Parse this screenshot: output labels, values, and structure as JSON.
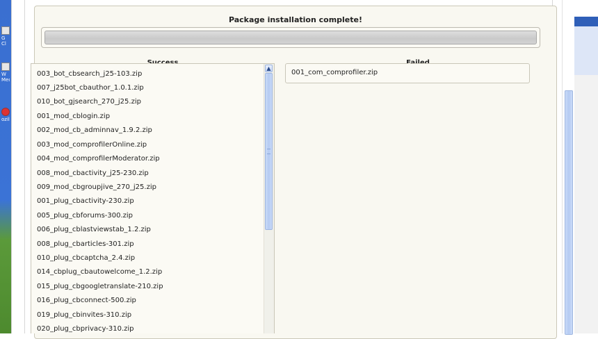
{
  "desktop": {
    "icons": [
      {
        "label": "G\nCl",
        "type": "app-icon"
      },
      {
        "label": "W\nMedi",
        "type": "media-icon"
      },
      {
        "label": "ozill",
        "type": "browser-icon"
      }
    ]
  },
  "install": {
    "title": "Package installation complete!",
    "progress": 1.0,
    "success_header": "Success",
    "failed_header": "Failed",
    "success_items": [
      "003_bot_cbsearch_j25-103.zip",
      "007_j25bot_cbauthor_1.0.1.zip",
      "010_bot_gjsearch_270_j25.zip",
      "001_mod_cblogin.zip",
      "002_mod_cb_adminnav_1.9.2.zip",
      "003_mod_comprofilerOnline.zip",
      "004_mod_comprofilerModerator.zip",
      "008_mod_cbactivity_j25-230.zip",
      "009_mod_cbgroupjive_270_j25.zip",
      "001_plug_cbactivity-230.zip",
      "005_plug_cbforums-300.zip",
      "006_plug_cblastviewstab_1.2.zip",
      "008_plug_cbarticles-301.zip",
      "010_plug_cbcaptcha_2.4.zip",
      "014_cbplug_cbautowelcome_1.2.zip",
      "015_plug_cbgoogletranslate-210.zip",
      "016_plug_cbconnect-500.zip",
      "019_plug_cbinvites-310.zip",
      "020_plug_cbprivacy-310.zip"
    ],
    "failed_items": [
      "001_com_comprofiler.zip"
    ]
  },
  "icons": {
    "scroll_up": "chevron-up-icon"
  }
}
